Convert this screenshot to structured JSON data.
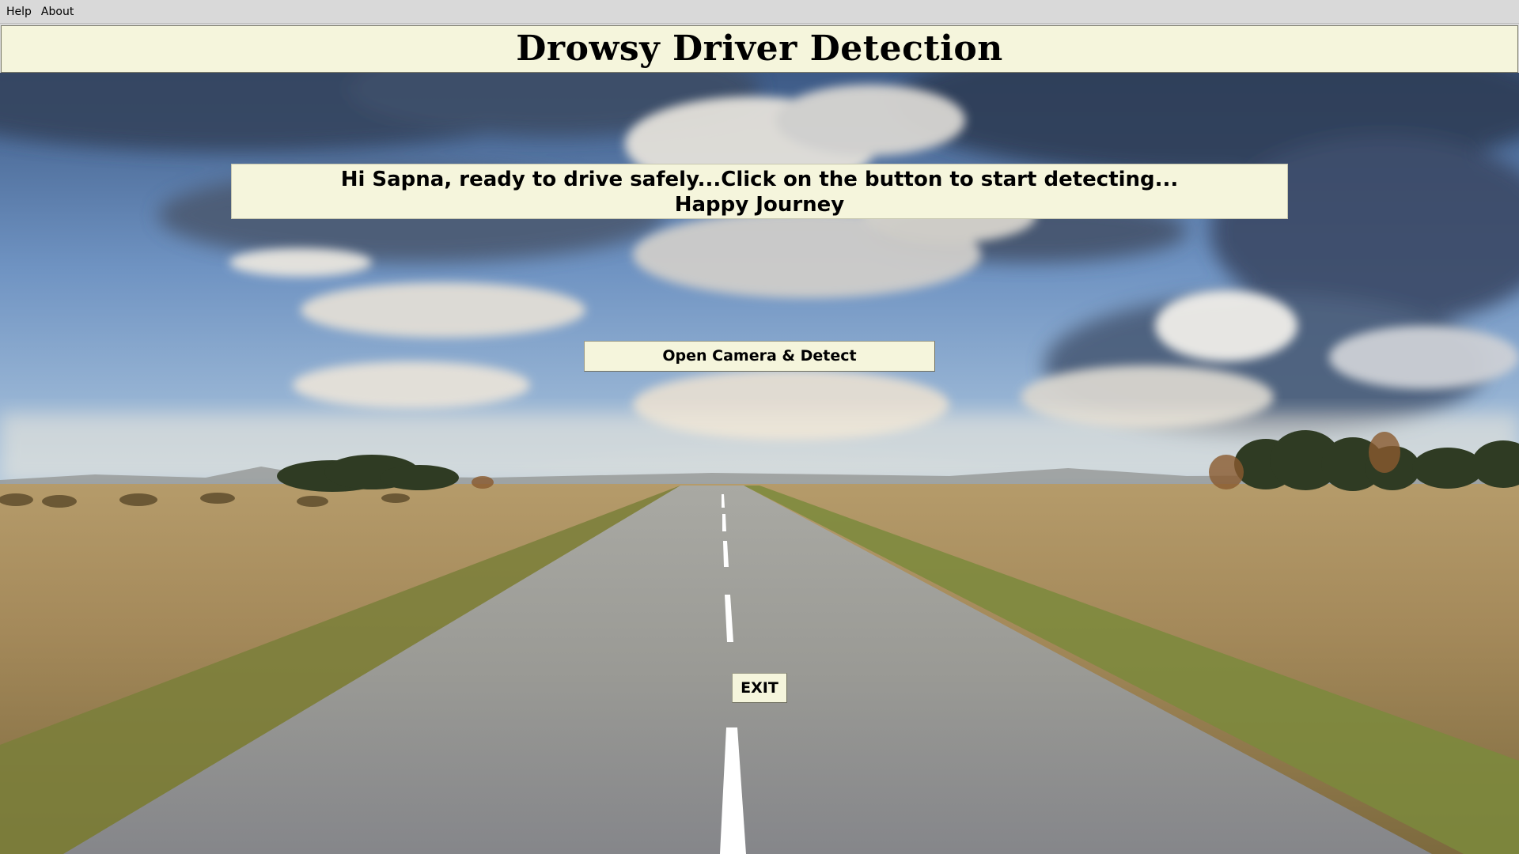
{
  "menubar": {
    "items": [
      {
        "label": "Help"
      },
      {
        "label": "About"
      }
    ]
  },
  "header": {
    "title": "Drowsy Driver Detection"
  },
  "greeting": {
    "line1": "Hi Sapna, ready to drive safely...Click on the button to start detecting...",
    "line2": "Happy Journey"
  },
  "actions": {
    "detect_label": "Open Camera & Detect",
    "exit_label": "EXIT"
  },
  "colors": {
    "panel_background": "#f5f5dc",
    "menubar_background": "#d9d9d9",
    "text": "#000000"
  }
}
